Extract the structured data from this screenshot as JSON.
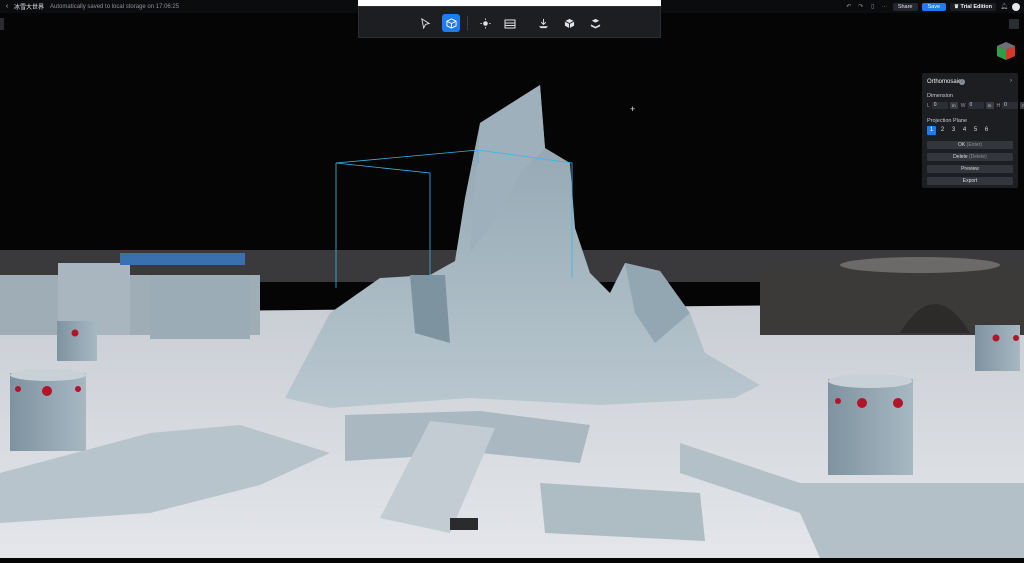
{
  "topbar": {
    "title": "冰雪大世界",
    "saved_text": "Automatically saved to local storage on 17:06:25",
    "share_label": "Share",
    "save_label": "Save",
    "trial_label": "Trial Edition"
  },
  "toolbar": {
    "tools": [
      {
        "name": "select-tool",
        "icon": "cursor-arrow-icon",
        "active": false
      },
      {
        "name": "model-view-tool",
        "icon": "cube-icon",
        "active": true
      },
      {
        "name": "lighting-tool",
        "icon": "sun-icon",
        "active": false
      },
      {
        "name": "texture-tool",
        "icon": "layers-icon",
        "active": false
      },
      {
        "name": "ground-tool",
        "icon": "ground-arrow-icon",
        "active": false
      },
      {
        "name": "box-tool",
        "icon": "box-icon",
        "active": false
      },
      {
        "name": "volume-tool",
        "icon": "volume-icon",
        "active": false
      }
    ]
  },
  "panel": {
    "title": "Orthomosaic",
    "dimension_label": "Dimension",
    "dimensions": [
      {
        "label": "L",
        "value": "0",
        "unit": "m"
      },
      {
        "label": "W",
        "value": "0",
        "unit": "m"
      },
      {
        "label": "H",
        "value": "0",
        "unit": "m"
      }
    ],
    "projection_label": "Projection Plane",
    "projection_options": [
      "1",
      "2",
      "3",
      "4",
      "5",
      "6"
    ],
    "projection_selected": "1",
    "ok_label": "OK",
    "ok_hint": "(Enter)",
    "delete_label": "Delete",
    "delete_hint": "(Delete)",
    "preview_label": "Preview",
    "export_label": "Export"
  },
  "colors": {
    "accent": "#1e7bf0",
    "background": "#050506",
    "panel": "#1e2024"
  }
}
